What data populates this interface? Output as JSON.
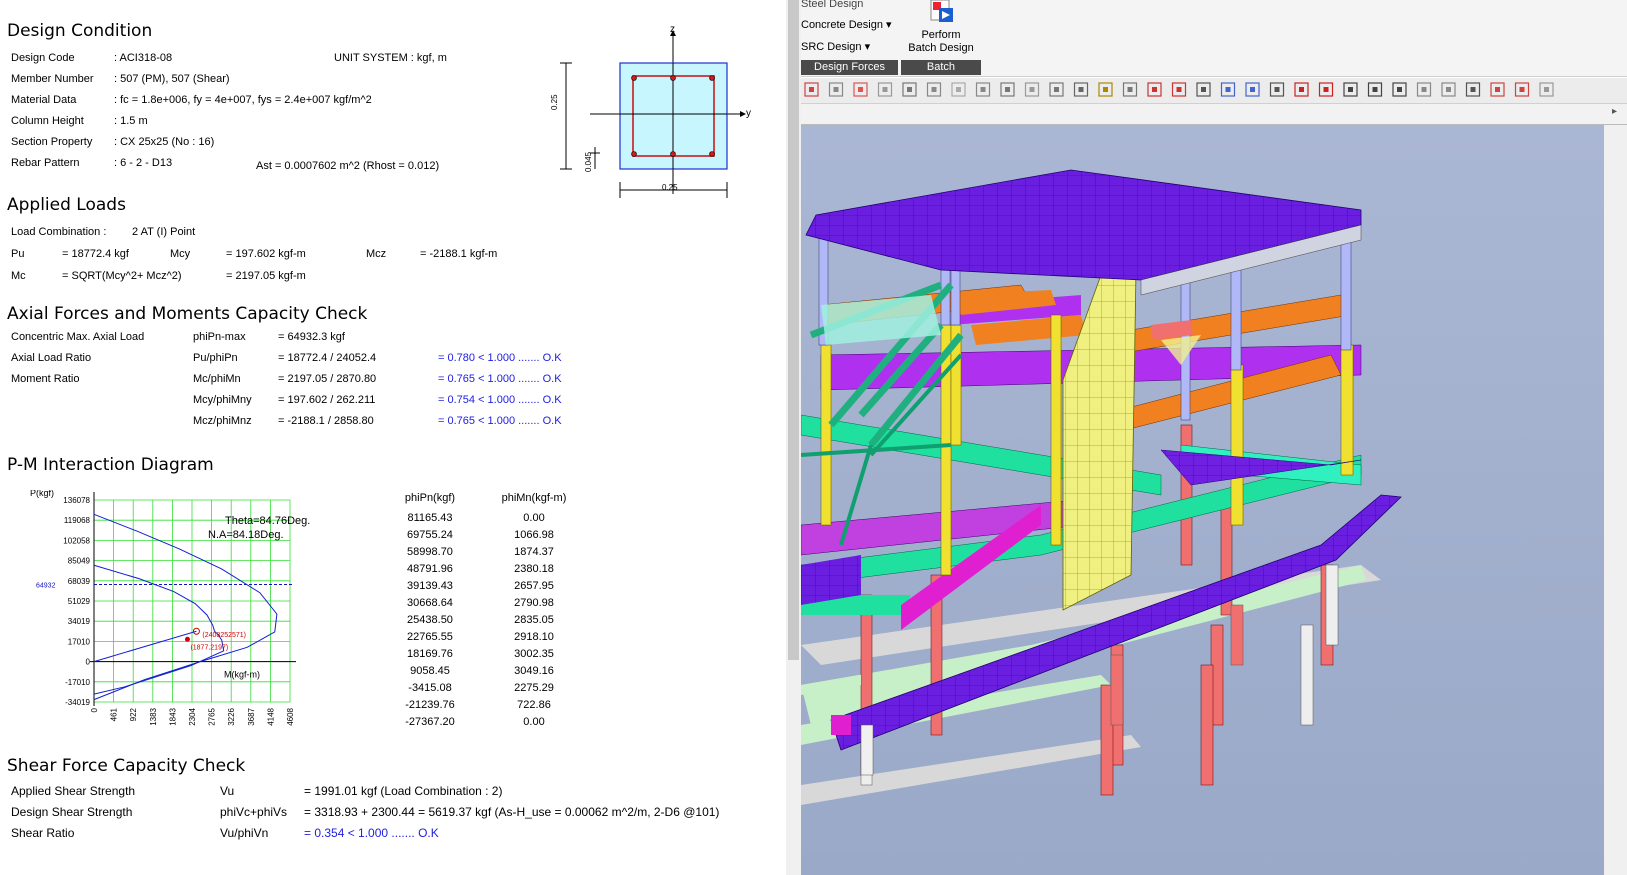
{
  "report": {
    "design_condition": {
      "title": "Design Condition",
      "rows": [
        {
          "label": "Design Code",
          "value": ":  ACI318-08"
        },
        {
          "label": "Member Number",
          "value": ":  507 (PM), 507 (Shear)"
        },
        {
          "label": "Material Data",
          "value": ":  fc = 1.8e+006,   fy = 4e+007,   fys = 2.4e+007 kgf/m^2"
        },
        {
          "label": "Column Height",
          "value": ":  1.5 m"
        },
        {
          "label": "Section Property",
          "value": ":  CX 25x25 (No : 16)"
        },
        {
          "label": "Rebar Pattern",
          "value": ":  6 - 2 - D13"
        }
      ],
      "unit_system": "UNIT SYSTEM  :  kgf, m",
      "ast": "Ast = 0.0007602 m^2   (Rhost = 0.012)",
      "section_labels": {
        "z": "z",
        "y": "y",
        "height": "0.25",
        "width": "0.25",
        "cover": "0.045"
      }
    },
    "applied_loads": {
      "title": "Applied Loads",
      "combo_label": "Load Combination  :",
      "combo_value": "2     AT (I) Point",
      "pu_label": "Pu",
      "pu_value": "= 18772.4 kgf",
      "mcy_label": "Mcy",
      "mcy_value": "= 197.602 kgf-m",
      "mcz_label": "Mcz",
      "mcz_value": "= -2188.1 kgf-m",
      "mc_label": "Mc",
      "mc_formula": "= SQRT(Mcy^2+ Mcz^2)",
      "mc_value": "= 2197.05 kgf-m"
    },
    "axial_check": {
      "title": "Axial Forces and Moments Capacity Check",
      "rows": [
        {
          "label": "Concentric Max. Axial Load",
          "sym": "phiPn-max",
          "val": "= 64932.3  kgf",
          "ratio": ""
        },
        {
          "label": "Axial Load Ratio",
          "sym": "Pu/phiPn",
          "val": "= 18772.4 / 24052.4",
          "ratio": "= 0.780  < 1.000 ....... O.K"
        },
        {
          "label": "Moment Ratio",
          "sym": "Mc/phiMn",
          "val": "= 2197.05 / 2870.80",
          "ratio": "= 0.765  < 1.000 ....... O.K"
        },
        {
          "label": "",
          "sym": "Mcy/phiMny",
          "val": "= 197.602 / 262.211",
          "ratio": "= 0.754  < 1.000 ....... O.K"
        },
        {
          "label": "",
          "sym": "Mcz/phiMnz",
          "val": "= -2188.1 / 2858.80",
          "ratio": "= 0.765  < 1.000 ....... O.K"
        }
      ]
    },
    "pm": {
      "title": "P-M Interaction Diagram",
      "ylabel": "P(kgf)",
      "xlabel": "M(kgf-m)",
      "theta": "Theta=84.76Deg.",
      "na": "N.A=84.18Deg.",
      "ref_label": "64932",
      "point1": "(1877.2197)",
      "point2": "(2408252571)",
      "yticks": [
        "136078",
        "119068",
        "102058",
        "85049",
        "68039",
        "51029",
        "34019",
        "17010",
        "0",
        "-17010",
        "-34019"
      ],
      "xticks": [
        "0",
        "461",
        "922",
        "1383",
        "1843",
        "2304",
        "2765",
        "3226",
        "3687",
        "4148",
        "4608"
      ],
      "table_headers": [
        "phiPn(kgf)",
        "phiMn(kgf-m)"
      ],
      "table": [
        [
          "81165.43",
          "0.00"
        ],
        [
          "69755.24",
          "1066.98"
        ],
        [
          "58998.70",
          "1874.37"
        ],
        [
          "48791.96",
          "2380.18"
        ],
        [
          "39139.43",
          "2657.95"
        ],
        [
          "30668.64",
          "2790.98"
        ],
        [
          "25438.50",
          "2835.05"
        ],
        [
          "22765.55",
          "2918.10"
        ],
        [
          "18169.76",
          "3002.35"
        ],
        [
          "9058.45",
          "3049.16"
        ],
        [
          "-3415.08",
          "2275.29"
        ],
        [
          "-21239.76",
          "722.86"
        ],
        [
          "-27367.20",
          "0.00"
        ]
      ]
    },
    "shear": {
      "title": "Shear Force Capacity Check",
      "rows": [
        {
          "label": "Applied Shear Strength",
          "sym": "Vu",
          "val": "= 1991.01  kgf  (Load Combination :   2)"
        },
        {
          "label": "Design Shear Strength",
          "sym": "phiVc+phiVs",
          "val": "= 3318.93 + 2300.44 = 5619.37  kgf  (As-H_use  = 0.00062 m^2/m,  2-D6  @101)"
        },
        {
          "label": "Shear Ratio",
          "sym": "Vu/phiVn",
          "val": "= 0.354  < 1.000 ....... O.K"
        }
      ]
    }
  },
  "app": {
    "ribbon": {
      "steel": "Steel Design",
      "concrete": "Concrete Design",
      "src": "SRC Design",
      "perform": "Perform",
      "batch_design": "Batch Design",
      "group1": "Design Forces",
      "group2": "Batch"
    },
    "colors": {
      "view_bg": "#a3b1cf",
      "slab": "#6a1fe0",
      "beam_purple": "#a020f0",
      "beam_orange": "#e07010",
      "beam_green": "#10d890",
      "column_yellow": "#f0e020",
      "column_red": "#f06060",
      "wall": "#f0f080"
    }
  }
}
